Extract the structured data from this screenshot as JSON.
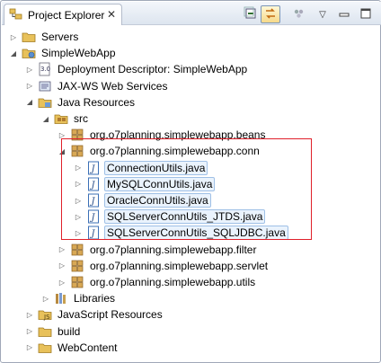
{
  "view": {
    "title": "Project Explorer",
    "tab_icon": "project-explorer-icon",
    "close_glyph": "✕",
    "menu_glyph": "▽",
    "toolbar": [
      "collapse-all-icon",
      "link-with-editor-icon",
      "view-menu-icon",
      "minimize-icon",
      "maximize-icon"
    ]
  },
  "tree": [
    {
      "label": "Servers",
      "icon": "folder-icon",
      "expander": "▷",
      "depth": 0
    },
    {
      "label": "SimpleWebApp",
      "icon": "web-project-icon",
      "expander": "◢",
      "depth": 0
    },
    {
      "label": "Deployment Descriptor: SimpleWebApp",
      "icon": "deployment-descriptor-icon",
      "expander": "▷",
      "depth": 1
    },
    {
      "label": "JAX-WS Web Services",
      "icon": "web-services-icon",
      "expander": "▷",
      "depth": 1
    },
    {
      "label": "Java Resources",
      "icon": "java-resources-icon",
      "expander": "◢",
      "depth": 1
    },
    {
      "label": "src",
      "icon": "source-folder-icon",
      "expander": "◢",
      "depth": 2
    },
    {
      "label": "org.o7planning.simplewebapp.beans",
      "icon": "package-icon",
      "expander": "▷",
      "depth": 3
    },
    {
      "label": "org.o7planning.simplewebapp.conn",
      "icon": "package-icon",
      "expander": "◢",
      "depth": 3
    },
    {
      "label": "ConnectionUtils.java",
      "icon": "java-file-icon",
      "expander": "▷",
      "depth": 4
    },
    {
      "label": "MySQLConnUtils.java",
      "icon": "java-file-icon",
      "expander": "▷",
      "depth": 4
    },
    {
      "label": "OracleConnUtils.java",
      "icon": "java-file-icon",
      "expander": "▷",
      "depth": 4
    },
    {
      "label": "SQLServerConnUtils_JTDS.java",
      "icon": "java-file-icon",
      "expander": "▷",
      "depth": 4
    },
    {
      "label": "SQLServerConnUtils_SQLJDBC.java",
      "icon": "java-file-icon",
      "expander": "▷",
      "depth": 4
    },
    {
      "label": "org.o7planning.simplewebapp.filter",
      "icon": "package-icon",
      "expander": "▷",
      "depth": 3
    },
    {
      "label": "org.o7planning.simplewebapp.servlet",
      "icon": "package-icon",
      "expander": "▷",
      "depth": 3
    },
    {
      "label": "org.o7planning.simplewebapp.utils",
      "icon": "package-icon",
      "expander": "▷",
      "depth": 3
    },
    {
      "label": "Libraries",
      "icon": "libraries-icon",
      "expander": "▷",
      "depth": 2
    },
    {
      "label": "JavaScript Resources",
      "icon": "javascript-resources-icon",
      "expander": "▷",
      "depth": 1
    },
    {
      "label": "build",
      "icon": "folder-icon",
      "expander": "▷",
      "depth": 1
    },
    {
      "label": "WebContent",
      "icon": "folder-icon",
      "expander": "▷",
      "depth": 1
    }
  ],
  "colors": {
    "highlight_border": "#e0202a",
    "selection_fill": "#eaf3fd",
    "selection_border": "#9fc0e6",
    "folder": "#e8c15a",
    "package": "#c8a050",
    "java_file_border": "#3b6fb6"
  }
}
